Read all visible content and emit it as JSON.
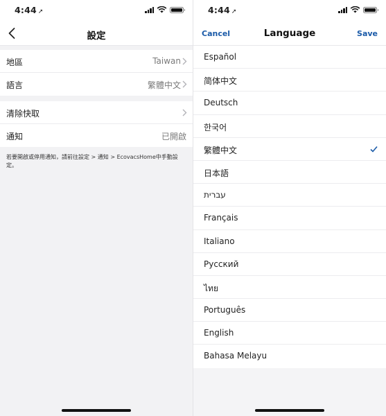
{
  "left": {
    "status": {
      "time": "4:44",
      "location_glyph": "➚"
    },
    "nav": {
      "title": "設定",
      "back_icon": "chevron-left-icon"
    },
    "group1": [
      {
        "label": "地區",
        "value": "Taiwan"
      },
      {
        "label": "語言",
        "value": "繁體中文"
      }
    ],
    "group2": [
      {
        "label": "清除快取",
        "value": ""
      },
      {
        "label": "通知",
        "value": "已開啟"
      }
    ],
    "note": "若要開啟或停用通知，請前往設定 > 通知 > EcovacsHome中手動設定。"
  },
  "right": {
    "status": {
      "time": "4:44",
      "location_glyph": "➚"
    },
    "nav": {
      "cancel": "Cancel",
      "title": "Language",
      "save": "Save"
    },
    "languages": [
      {
        "name": "Español"
      },
      {
        "name": "简体中文"
      },
      {
        "name": "Deutsch"
      },
      {
        "name": "한국어"
      },
      {
        "name": "繁體中文",
        "selected": true
      },
      {
        "name": "日本語"
      },
      {
        "name": "עברית"
      },
      {
        "name": "Français"
      },
      {
        "name": "Italiano"
      },
      {
        "name": "Русский"
      },
      {
        "name": "ไทย"
      },
      {
        "name": "Português"
      },
      {
        "name": "English"
      },
      {
        "name": "Bahasa Melayu"
      }
    ]
  },
  "colors": {
    "accent": "#1a5aa8",
    "background": "#f2f2f4",
    "secondary_text": "#7a7a7a"
  }
}
